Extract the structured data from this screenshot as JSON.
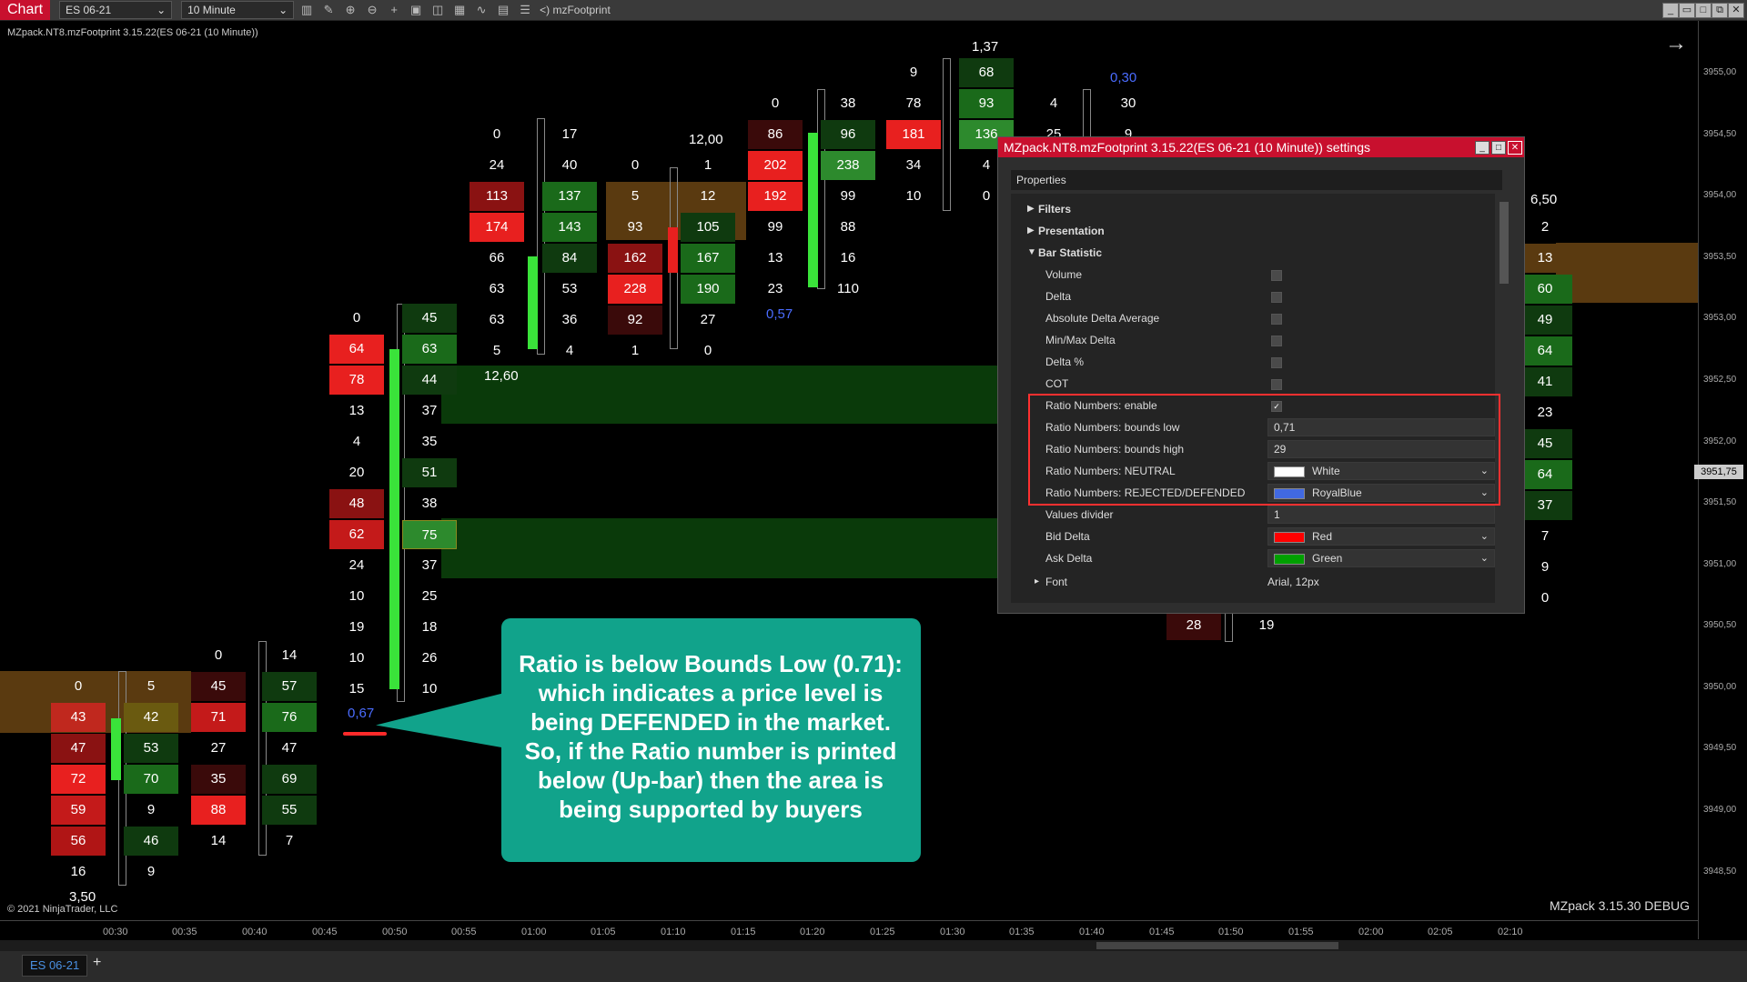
{
  "toolbar": {
    "chart_tab": "Chart",
    "instrument": "ES 06-21",
    "timeframe": "10 Minute",
    "indicator_label": "<) mzFootprint",
    "icons": [
      "bar-type-icon",
      "draw-icon",
      "zoom-in-icon",
      "zoom-out-icon",
      "crosshair-icon",
      "data-box-icon",
      "properties-icon",
      "indicators-icon",
      "strategies-icon",
      "templates-icon",
      "menu-icon"
    ]
  },
  "chart": {
    "title": "MZpack.NT8.mzFootprint 3.15.22(ES 06-21 (10 Minute))",
    "copyright": "© 2021 NinjaTrader, LLC",
    "build": "MZpack 3.15.30 DEBUG",
    "current_price": "3951,75",
    "price_labels": [
      "3955,00",
      "3954,50",
      "3954,00",
      "3953,50",
      "3953,00",
      "3952,50",
      "3952,00",
      "3951,50",
      "3951,00",
      "3950,50",
      "3950,00",
      "3949,50",
      "3949,00",
      "3948,50"
    ],
    "time_labels": [
      "00:30",
      "00:35",
      "00:40",
      "00:45",
      "00:50",
      "00:55",
      "01:00",
      "01:05",
      "01:10",
      "01:15",
      "01:20",
      "01:25",
      "01:30",
      "01:35",
      "01:40",
      "01:45",
      "01:50",
      "01:55",
      "02:00",
      "02:05",
      "02:10"
    ],
    "instrument_tab": "ES 06-21",
    "colors": {
      "bid": "#e8201f",
      "ask": "#2d8a2d",
      "poc": "#5a3a10",
      "body": "#3ae33a",
      "ratio": "#4a6cff"
    }
  },
  "footprints": {
    "bar1": {
      "bids": [
        "0",
        "43",
        "47",
        "72",
        "59",
        "56",
        "16"
      ],
      "asks": [
        "5",
        "42",
        "53",
        "70",
        "9",
        "46",
        "9"
      ],
      "bottom": "3,50"
    },
    "bar2": {
      "bids": [
        "0",
        "45",
        "71",
        "27",
        "35",
        "88",
        "14"
      ],
      "asks": [
        "14",
        "57",
        "76",
        "47",
        "69",
        "55",
        "7"
      ]
    },
    "bar3": {
      "bids": [
        "0",
        "64",
        "78",
        "13",
        "4",
        "20",
        "48",
        "62",
        "24",
        "10",
        "19",
        "10",
        "15"
      ],
      "asks": [
        "45",
        "63",
        "44",
        "37",
        "35",
        "51",
        "38",
        "75",
        "37",
        "25",
        "18",
        "26",
        "10"
      ],
      "ratio": "0,67",
      "delta_top": "12,60"
    },
    "bar4": {
      "bids": [
        "0",
        "24",
        "113",
        "174",
        "66",
        "63",
        "63",
        "5"
      ],
      "asks": [
        "17",
        "40",
        "137",
        "143",
        "84",
        "53",
        "36",
        "4"
      ]
    },
    "bar5": {
      "bids": [
        "0",
        "5",
        "93",
        "162",
        "228",
        "92",
        "1"
      ],
      "asks": [
        "1",
        "12",
        "105",
        "167",
        "190",
        "27",
        "0"
      ],
      "top": "12,00"
    },
    "bar6": {
      "bids": [
        "0",
        "86",
        "202",
        "192",
        "99",
        "13",
        "23"
      ],
      "asks": [
        "38",
        "96",
        "238",
        "99",
        "88",
        "16",
        "110"
      ],
      "ratio": "0,57"
    },
    "bar7": {
      "bids": [
        "9",
        "78",
        "181",
        "34",
        "10"
      ],
      "asks": [
        "68",
        "93",
        "136",
        "4",
        "0"
      ],
      "top": "1,37"
    },
    "bar8": {
      "bids": [
        "4",
        "25"
      ],
      "asks": [
        "30",
        "9"
      ],
      "ratio": "0,30"
    },
    "bar9": {
      "bids": [
        "28"
      ],
      "asks": [
        "19"
      ]
    },
    "bar10": {
      "asks": [
        "2",
        "13",
        "60",
        "49",
        "64",
        "41",
        "23",
        "45",
        "64",
        "37",
        "7",
        "9",
        "0"
      ],
      "top": "6,50"
    }
  },
  "callout": {
    "text": "Ratio is below Bounds Low (0.71): which indicates a price level is being DEFENDED in the market. So, if the Ratio number is printed below (Up-bar) then the area is being supported by buyers"
  },
  "dialog": {
    "title": "MZpack.NT8.mzFootprint 3.15.22(ES 06-21 (10 Minute)) settings",
    "properties_label": "Properties",
    "sections": {
      "filters": "Filters",
      "presentation": "Presentation",
      "bar_statistic": "Bar Statistic",
      "font": "Font"
    },
    "rows": {
      "volume": "Volume",
      "delta": "Delta",
      "abs_delta": "Absolute Delta Average",
      "minmax": "Min/Max Delta",
      "delta_pct": "Delta %",
      "cot": "COT",
      "ratio_enable": "Ratio Numbers: enable",
      "bounds_low": "Ratio Numbers: bounds low",
      "bounds_high": "Ratio Numbers: bounds high",
      "neutral": "Ratio Numbers: NEUTRAL",
      "rejected": "Ratio Numbers: REJECTED/DEFENDED",
      "divider": "Values divider",
      "bid_delta": "Bid Delta",
      "ask_delta": "Ask Delta"
    },
    "values": {
      "ratio_enable_check": "✓",
      "bounds_low": "0,71",
      "bounds_high": "29",
      "neutral": "White",
      "rejected": "RoyalBlue",
      "divider": "1",
      "bid_delta": "Red",
      "ask_delta": "Green",
      "font": "Arial, 12px"
    },
    "swatches": {
      "neutral": "#ffffff",
      "rejected": "#4169e1",
      "bid_delta": "#ff0000",
      "ask_delta": "#00a000"
    }
  }
}
